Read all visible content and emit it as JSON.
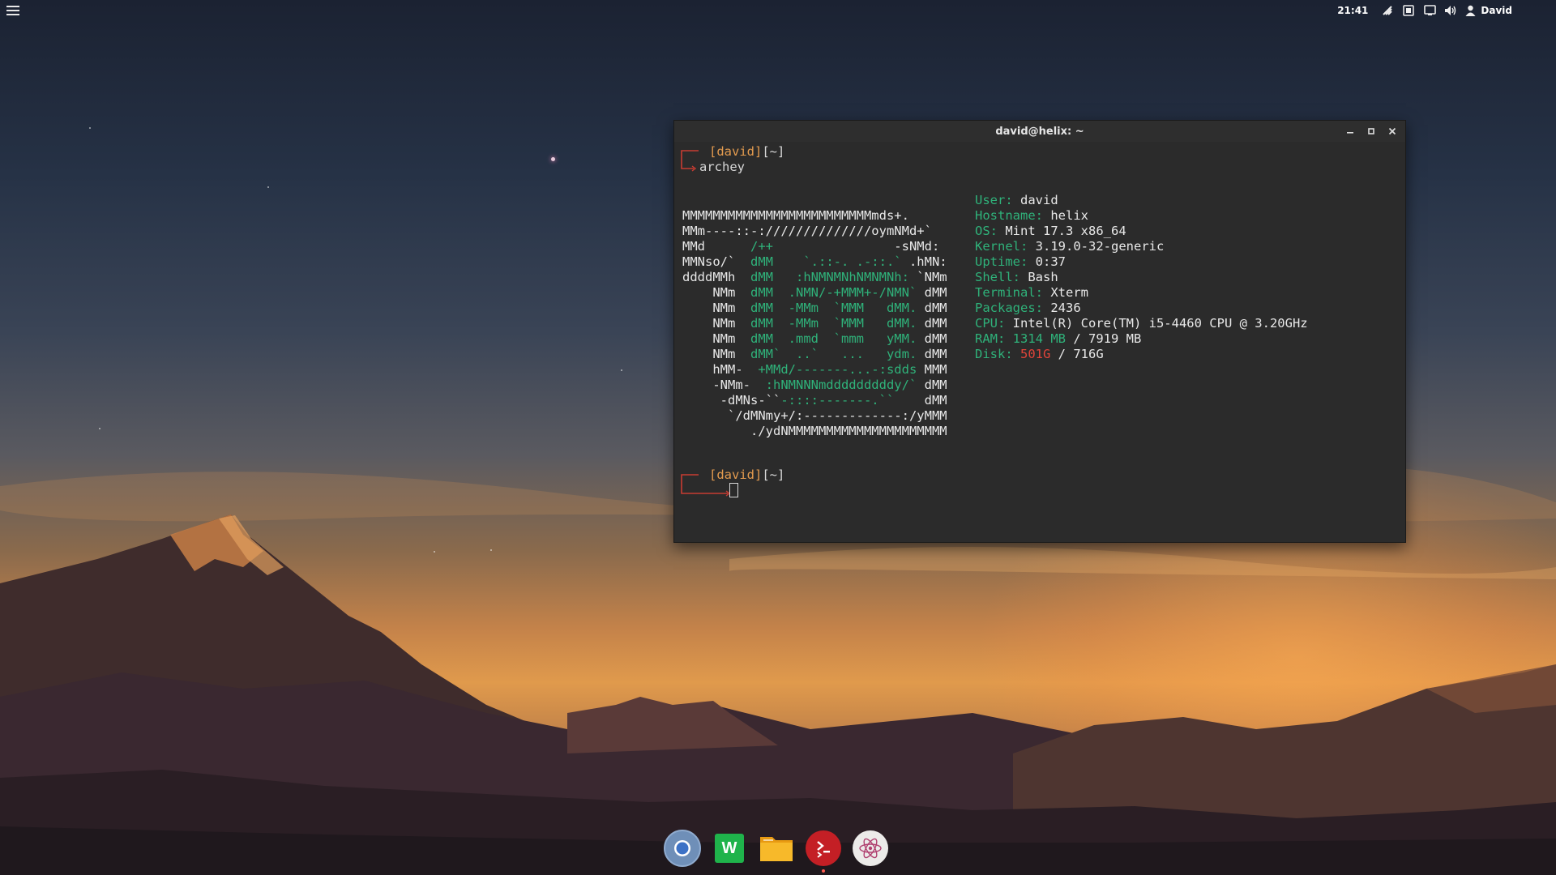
{
  "panel": {
    "clock": "21:41",
    "user": "David",
    "tray_icons": [
      "network-icon",
      "keyboard-icon",
      "display-icon",
      "volume-icon",
      "user-icon"
    ]
  },
  "terminal": {
    "title": "david@helix: ~",
    "prompt_user": "[david]",
    "prompt_dir": "[~]",
    "command": "archey",
    "logo": [
      [
        [
          "MMMMMMMMMMMMMMMMMMMMMMMMMmds+.",
          "w"
        ]
      ],
      [
        [
          "MMm----::-://////////////oymNMd+`",
          "w"
        ]
      ],
      [
        [
          "MMd      ",
          "w"
        ],
        [
          "/++",
          "g"
        ],
        [
          "                -sNMd:",
          "w"
        ]
      ],
      [
        [
          "MMNso/`  ",
          "w"
        ],
        [
          "dMM    `.::-. .-::.`",
          "g"
        ],
        [
          " .hMN:",
          "w"
        ]
      ],
      [
        [
          "ddddMMh  ",
          "w"
        ],
        [
          "dMM   :hNMNMNhNMNMNh:",
          "g"
        ],
        [
          " `NMm",
          "w"
        ]
      ],
      [
        [
          "    NMm  ",
          "w"
        ],
        [
          "dMM  .NMN/-+MMM+-/NMN`",
          "g"
        ],
        [
          " dMM",
          "w"
        ]
      ],
      [
        [
          "    NMm  ",
          "w"
        ],
        [
          "dMM  -MMm  `MMM   dMM.",
          "g"
        ],
        [
          " dMM",
          "w"
        ]
      ],
      [
        [
          "    NMm  ",
          "w"
        ],
        [
          "dMM  -MMm  `MMM   dMM.",
          "g"
        ],
        [
          " dMM",
          "w"
        ]
      ],
      [
        [
          "    NMm  ",
          "w"
        ],
        [
          "dMM  .mmd  `mmm   yMM.",
          "g"
        ],
        [
          " dMM",
          "w"
        ]
      ],
      [
        [
          "    NMm  ",
          "w"
        ],
        [
          "dMM`  ..`   ...   ydm.",
          "g"
        ],
        [
          " dMM",
          "w"
        ]
      ],
      [
        [
          "    hMM-  ",
          "w"
        ],
        [
          "+MMd/-------...-:sdds",
          "g"
        ],
        [
          " MMM",
          "w"
        ]
      ],
      [
        [
          "    -NMm-  ",
          "w"
        ],
        [
          ":hNMNNNmdddddddddy/`",
          "g"
        ],
        [
          " dMM",
          "w"
        ]
      ],
      [
        [
          "     -dMNs-``",
          "w"
        ],
        [
          "-::::-------.``",
          "g"
        ],
        [
          "    dMM",
          "w"
        ]
      ],
      [
        [
          "      `/dMNmy+/:-------------:/yMMM",
          "w"
        ]
      ],
      [
        [
          "         ./ydNMMMMMMMMMMMMMMMMMMMMM",
          "w"
        ]
      ]
    ],
    "info": [
      {
        "label": "User:",
        "value": "david"
      },
      {
        "label": "Hostname:",
        "value": "helix"
      },
      {
        "label": "OS:",
        "value": "Mint 17.3 x86_64"
      },
      {
        "label": "Kernel:",
        "value": "3.19.0-32-generic"
      },
      {
        "label": "Uptime:",
        "value": "0:37"
      },
      {
        "label": "Shell:",
        "value": "Bash"
      },
      {
        "label": "Terminal:",
        "value": "Xterm"
      },
      {
        "label": "Packages:",
        "value": "2436"
      },
      {
        "label": "CPU:",
        "value": "Intel(R) Core(TM) i5-4460 CPU @ 3.20GHz"
      },
      {
        "label": "RAM:",
        "used": "1314 MB",
        "rest": " / 7919 MB",
        "used_color": "green"
      },
      {
        "label": "Disk:",
        "used": "501G",
        "rest": " / 716G",
        "used_color": "red"
      }
    ]
  },
  "dock": {
    "items": [
      {
        "name": "chromium-icon"
      },
      {
        "name": "wps-writer-icon"
      },
      {
        "name": "file-manager-icon"
      },
      {
        "name": "terminal-icon",
        "running": true
      },
      {
        "name": "atom-editor-icon"
      }
    ],
    "writer_letter": "W",
    "terminal_glyph": ">_"
  },
  "colors": {
    "accent_orange": "#e39b4f",
    "accent_green": "#2fb27a",
    "accent_red": "#e0443a"
  }
}
